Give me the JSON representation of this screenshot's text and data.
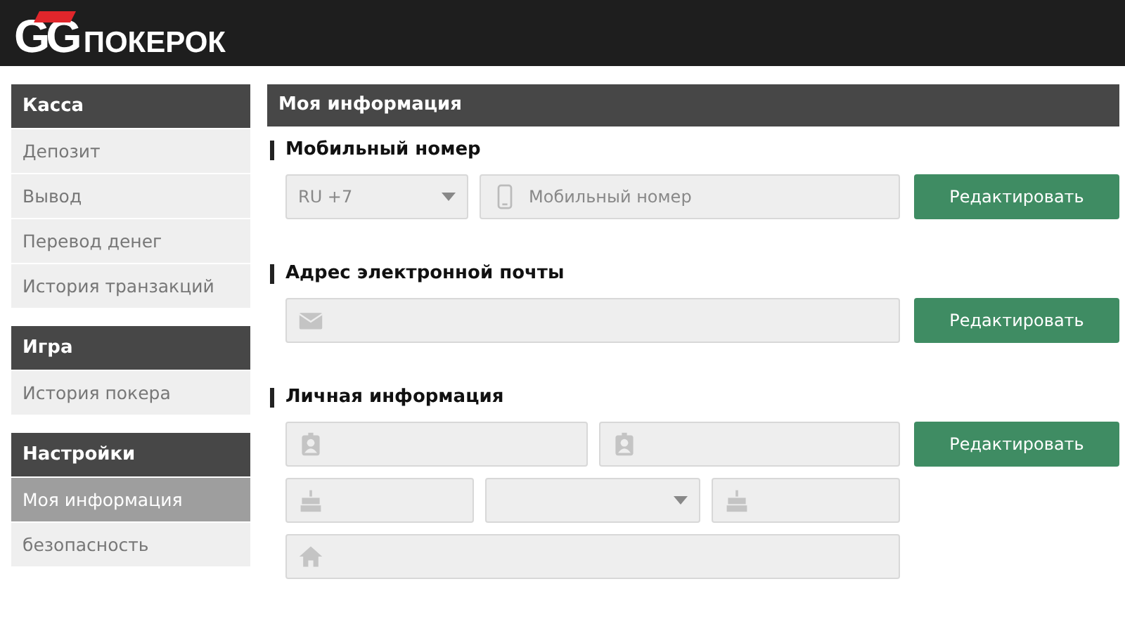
{
  "header": {
    "logo_mark": "GG",
    "logo_text": "ПОКЕРОК"
  },
  "sidebar": {
    "groups": [
      {
        "title": "Касса",
        "items": [
          {
            "label": "Депозит",
            "selected": false
          },
          {
            "label": "Вывод",
            "selected": false
          },
          {
            "label": "Перевод денег",
            "selected": false
          },
          {
            "label": "История транзакций",
            "selected": false
          }
        ]
      },
      {
        "title": "Игра",
        "items": [
          {
            "label": "История покера",
            "selected": false
          }
        ]
      },
      {
        "title": "Настройки",
        "items": [
          {
            "label": "Моя информация",
            "selected": true
          },
          {
            "label": "безопасность",
            "selected": false
          }
        ]
      }
    ]
  },
  "main": {
    "title": "Моя информация",
    "sections": [
      {
        "title": "Мобильный номер",
        "button": "Редактировать",
        "rows": [
          [
            {
              "kind": "select",
              "value": "RU +7"
            },
            {
              "kind": "phone",
              "placeholder": "Мобильный номер"
            }
          ]
        ]
      },
      {
        "title": "Адрес электронной почты",
        "button": "Редактировать",
        "rows": [
          [
            {
              "kind": "email"
            }
          ]
        ]
      },
      {
        "title": "Личная информация",
        "button": "Редактировать",
        "rows": [
          [
            {
              "kind": "person"
            },
            {
              "kind": "person"
            }
          ],
          [
            {
              "kind": "birthday"
            },
            {
              "kind": "select"
            },
            {
              "kind": "birthday"
            }
          ],
          [
            {
              "kind": "address"
            }
          ]
        ]
      }
    ]
  }
}
